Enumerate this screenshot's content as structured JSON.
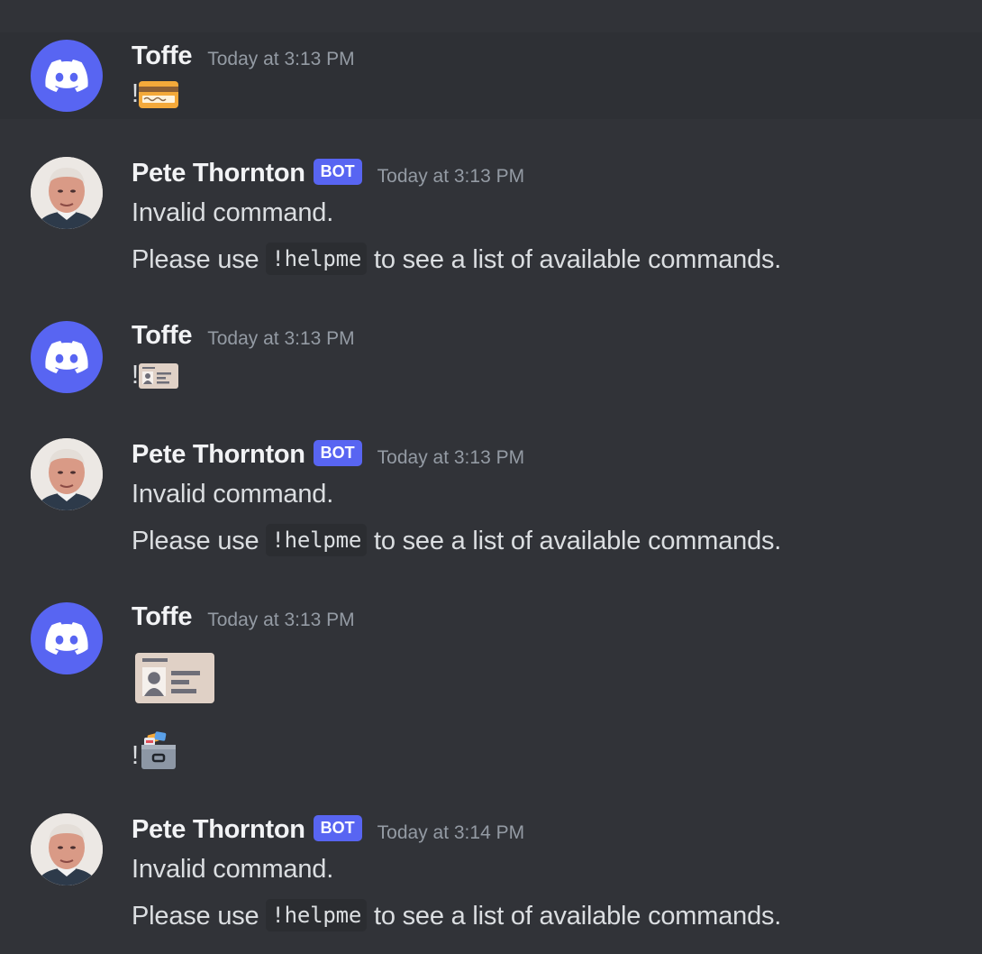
{
  "messages": [
    {
      "author": "Toffe",
      "timestamp": "Today at 3:13 PM",
      "is_bot": false,
      "content_prefix": "!",
      "emoji": "credit-card-icon"
    },
    {
      "author": "Pete Thornton",
      "bot_tag": "BOT",
      "timestamp": "Today at 3:13 PM",
      "is_bot": true,
      "line1": "Invalid command.",
      "line2_before": "Please use",
      "command": "!helpme",
      "line2_after": "to see a list of available commands."
    },
    {
      "author": "Toffe",
      "timestamp": "Today at 3:13 PM",
      "is_bot": false,
      "content_prefix": "!",
      "emoji": "id-card-icon"
    },
    {
      "author": "Pete Thornton",
      "bot_tag": "BOT",
      "timestamp": "Today at 3:13 PM",
      "is_bot": true,
      "line1": "Invalid command.",
      "line2_before": "Please use",
      "command": "!helpme",
      "line2_after": "to see a list of available commands."
    },
    {
      "author": "Toffe",
      "timestamp": "Today at 3:13 PM",
      "is_bot": false,
      "jumbo_emoji": "id-card-icon",
      "content_prefix": "!",
      "emoji": "card-file-box-icon"
    },
    {
      "author": "Pete Thornton",
      "bot_tag": "BOT",
      "timestamp": "Today at 3:14 PM",
      "is_bot": true,
      "line1": "Invalid command.",
      "line2_before": "Please use",
      "command": "!helpme",
      "line2_after": "to see a list of available commands."
    }
  ],
  "colors": {
    "background": "#313338",
    "highlight": "#2e3035",
    "blurple": "#5865f2",
    "username": "#f2f3f5",
    "timestamp": "#949ba4",
    "code_bg": "#2b2d31"
  }
}
